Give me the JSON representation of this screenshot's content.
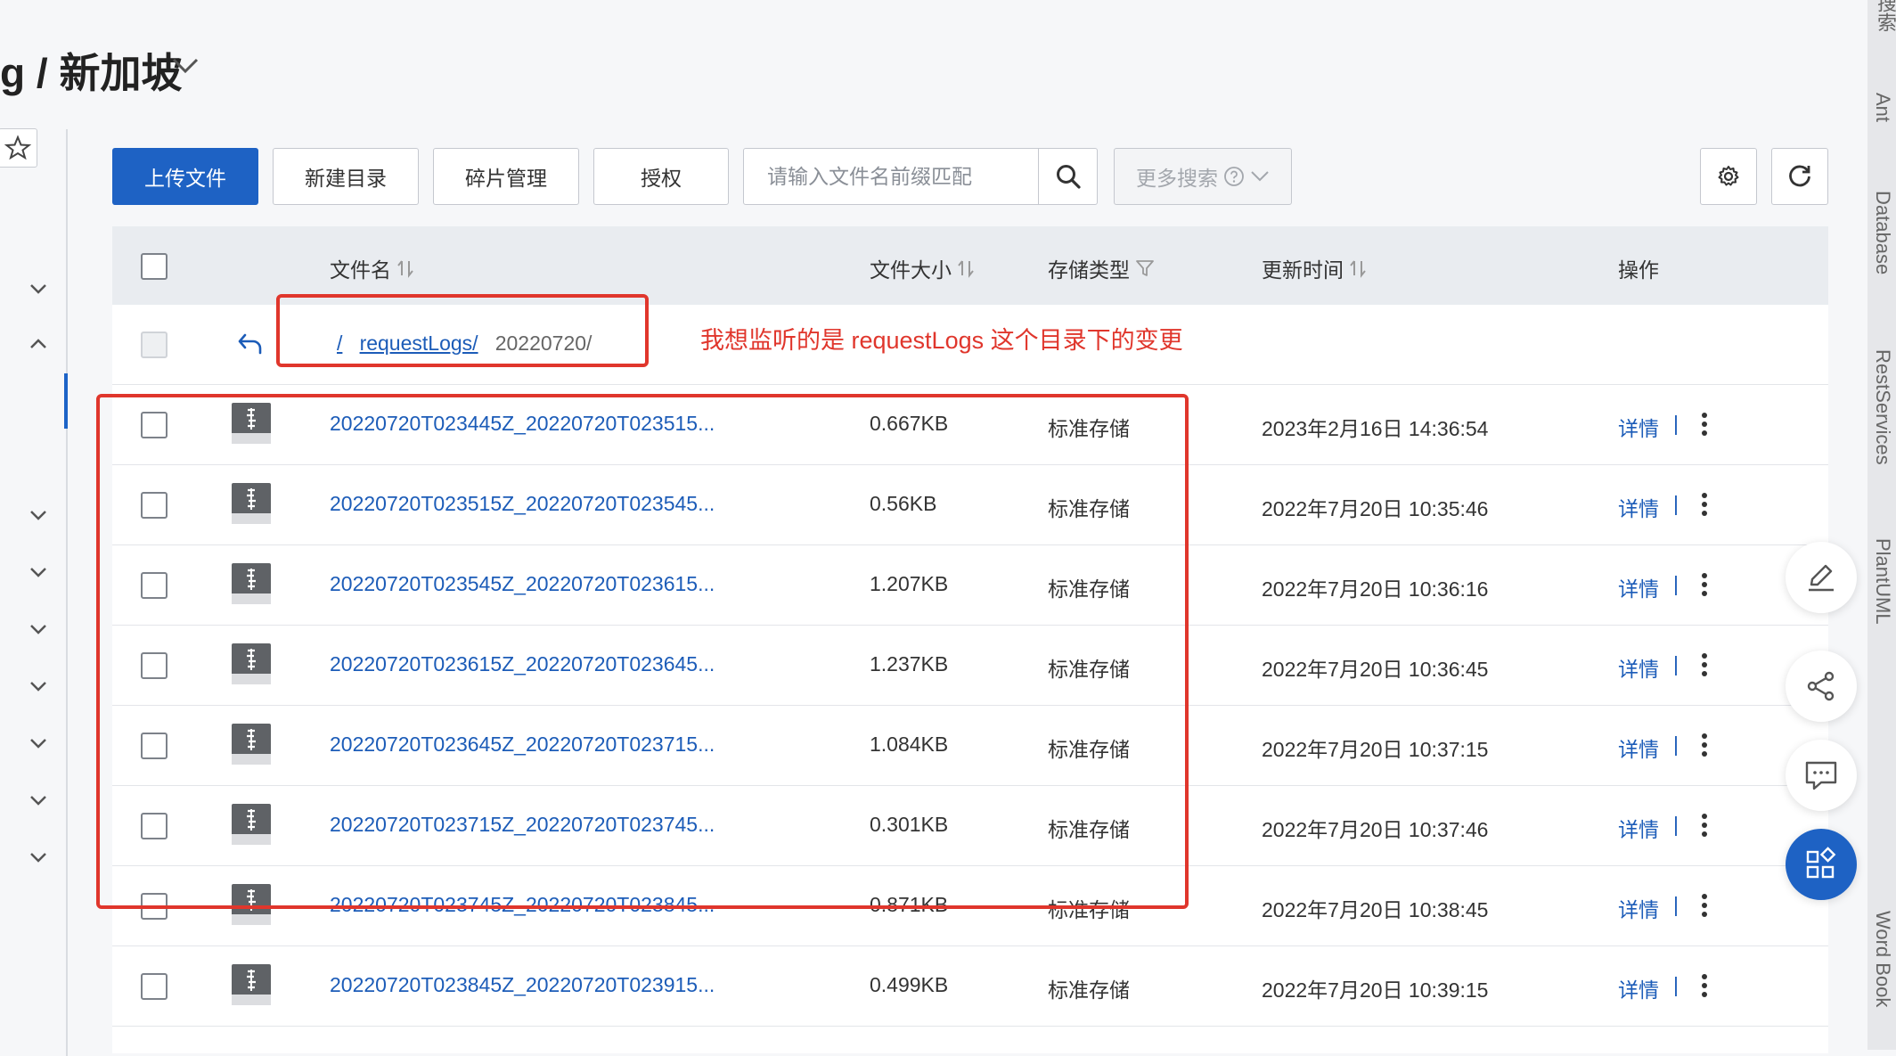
{
  "header": {
    "title": "g / 新加坡"
  },
  "toolbar": {
    "upload_label": "上传文件",
    "new_dir_label": "新建目录",
    "fragment_label": "碎片管理",
    "auth_label": "授权",
    "search_placeholder": "请输入文件名前缀匹配",
    "more_search_label": "更多搜索"
  },
  "table": {
    "columns": [
      "文件名",
      "文件大小",
      "存储类型",
      "更新时间",
      "操作"
    ],
    "breadcrumb": {
      "root": "/",
      "dir": "requestLogs/",
      "current": "20220720/"
    },
    "rows": [
      {
        "name": "20220720T023445Z_20220720T023515...",
        "size": "0.667KB",
        "storage": "标准存储",
        "time": "2023年2月16日 14:36:54",
        "action": "详情"
      },
      {
        "name": "20220720T023515Z_20220720T023545...",
        "size": "0.56KB",
        "storage": "标准存储",
        "time": "2022年7月20日 10:35:46",
        "action": "详情"
      },
      {
        "name": "20220720T023545Z_20220720T023615...",
        "size": "1.207KB",
        "storage": "标准存储",
        "time": "2022年7月20日 10:36:16",
        "action": "详情"
      },
      {
        "name": "20220720T023615Z_20220720T023645...",
        "size": "1.237KB",
        "storage": "标准存储",
        "time": "2022年7月20日 10:36:45",
        "action": "详情"
      },
      {
        "name": "20220720T023645Z_20220720T023715...",
        "size": "1.084KB",
        "storage": "标准存储",
        "time": "2022年7月20日 10:37:15",
        "action": "详情"
      },
      {
        "name": "20220720T023715Z_20220720T023745...",
        "size": "0.301KB",
        "storage": "标准存储",
        "time": "2022年7月20日 10:37:46",
        "action": "详情"
      },
      {
        "name": "20220720T023745Z_20220720T023845...",
        "size": "0.871KB",
        "storage": "标准存储",
        "time": "2022年7月20日 10:38:45",
        "action": "详情"
      },
      {
        "name": "20220720T023845Z_20220720T023915...",
        "size": "0.499KB",
        "storage": "标准存储",
        "time": "2022年7月20日 10:39:15",
        "action": "详情"
      }
    ]
  },
  "annotation": {
    "text": "我想监听的是 requestLogs 这个目录下的变更",
    "color": "#e0362c"
  },
  "side_panel": {
    "labels": [
      "Ant",
      "Database",
      "RestServices",
      "PlantUML",
      "Word Book"
    ]
  },
  "colors": {
    "primary": "#1e62c4",
    "link": "#1c5cb8"
  }
}
